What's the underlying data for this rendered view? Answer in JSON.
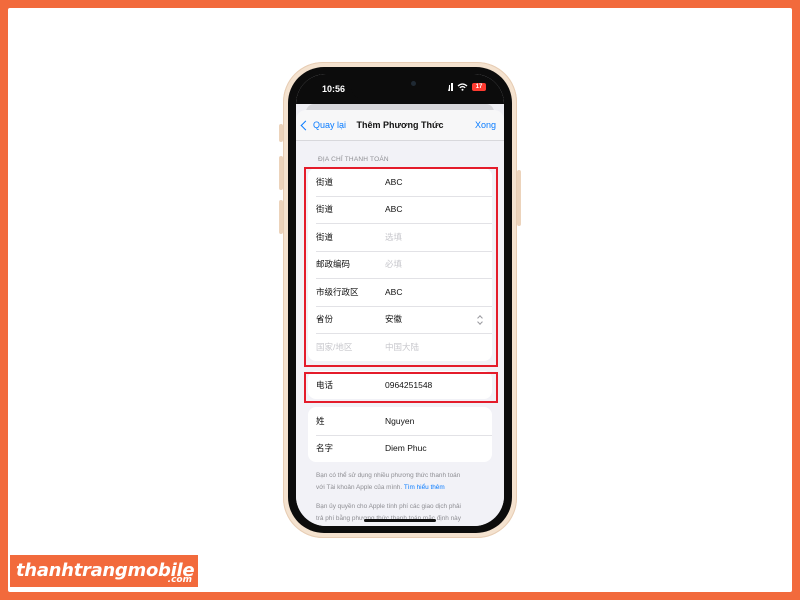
{
  "status_bar": {
    "time": "10:56",
    "battery": "17"
  },
  "nav": {
    "back_label": "Quay lại",
    "title": "Thêm Phương Thức",
    "done_label": "Xong"
  },
  "section_label": "ĐỊA CHỈ THANH TOÁN",
  "address_rows": [
    {
      "label": "街道",
      "value": "ABC"
    },
    {
      "label": "街道",
      "value": "ABC"
    },
    {
      "label": "街道",
      "value": "选填"
    },
    {
      "label": "邮政编码",
      "value": "必填"
    },
    {
      "label": "市级行政区",
      "value": "ABC"
    },
    {
      "label": "省份",
      "value": "安徽"
    },
    {
      "label": "国家/地区",
      "value": "中国大陆"
    }
  ],
  "phone_row": {
    "label": "电话",
    "value": "0964251548"
  },
  "name_rows": [
    {
      "label": "姓",
      "value": "Nguyen"
    },
    {
      "label": "名字",
      "value": "Diem Phuc"
    }
  ],
  "footer": {
    "p1_line1": "Bạn có thể sử dụng nhiều phương thức thanh toán",
    "p1_line2": "với Tài khoản Apple của mình.",
    "p1_link": "Tìm hiểu thêm",
    "p2_line1": "Bạn ủy quyền cho Apple tính phí các giao dịch phải",
    "p2_line2": "trả phí bằng phương thức thanh toán mặc định này"
  },
  "brand": {
    "name": "thanhtrangmobile",
    "domain": ".com"
  },
  "colors": {
    "background": "#f26a3c",
    "highlight": "#e41c2b",
    "ios_blue": "#0a7cff"
  }
}
